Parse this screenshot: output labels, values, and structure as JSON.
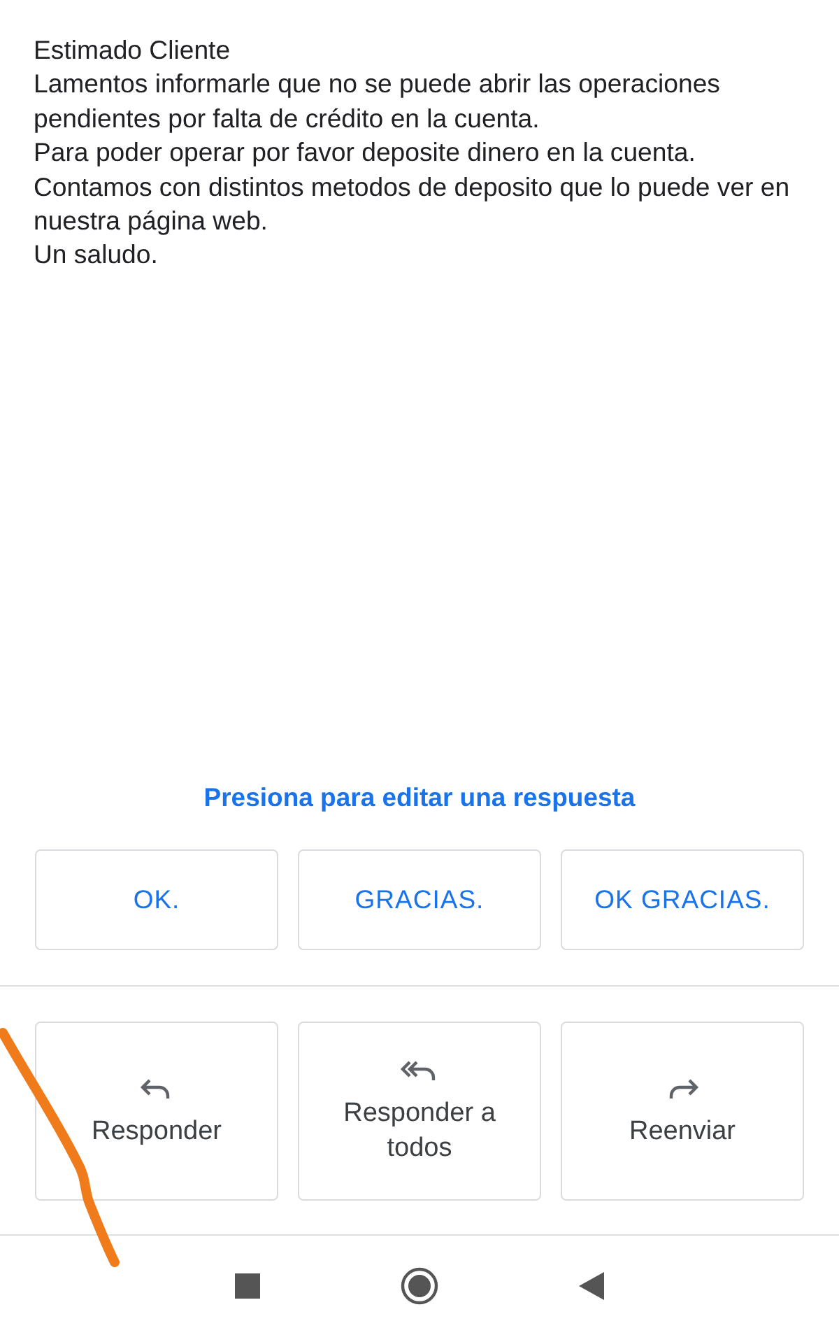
{
  "message": {
    "paragraphs": [
      "Estimado Cliente",
      "Lamentos informarle que no se puede abrir las operaciones pendientes por falta de crédito en la cuenta.",
      "Para poder operar por favor deposite dinero en la cuenta.",
      "Contamos con distintos metodos de deposito que lo puede ver en nuestra página web.",
      "Un saludo."
    ]
  },
  "smart_reply": {
    "hint": "Presiona para editar una respuesta",
    "suggestions": [
      "OK.",
      "GRACIAS.",
      "OK GRACIAS."
    ]
  },
  "actions": [
    {
      "kind": "reply",
      "label": "Responder"
    },
    {
      "kind": "reply_all",
      "label": "Responder a todos"
    },
    {
      "kind": "forward",
      "label": "Reenviar"
    }
  ],
  "nav_bar": [
    {
      "kind": "recents"
    },
    {
      "kind": "home"
    },
    {
      "kind": "back"
    }
  ]
}
